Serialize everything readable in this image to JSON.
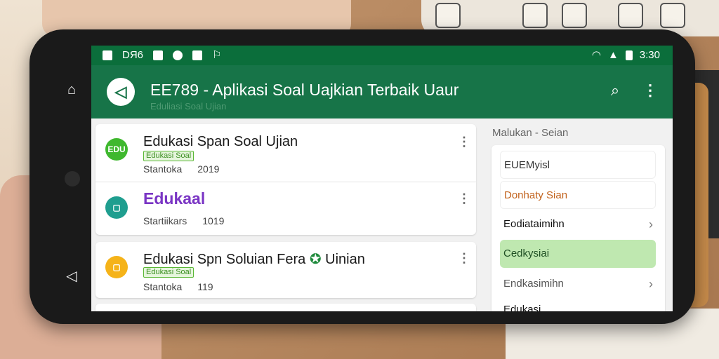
{
  "status_bar": {
    "left_text": "DЯ6",
    "time": "3:30"
  },
  "app_bar": {
    "title": "EE789 - Aplikasi Soal Uajkian Terbaik Uaur",
    "subtitle": "Eduliasi Soal  Ujian"
  },
  "list": {
    "items": [
      {
        "title": "Edukasi Span Soal Ujian",
        "tag": "Edukasi Soal",
        "meta_left": "Stantoka",
        "meta_right": "2019",
        "icon_text": "EDU",
        "icon_color": "#3fb82e",
        "title_color": "#1a1a1a"
      },
      {
        "title": "Edukaal",
        "tag": "",
        "meta_left": "Startiikars",
        "meta_right": "1019",
        "icon_text": "",
        "icon_color": "#1f9e8f",
        "title_color": "#7a35c4"
      },
      {
        "title": "Edukasi Spn Soluian Fera",
        "title_suffix": "Uinian",
        "tag": "Edukasi Soal",
        "meta_left": "Stantoka",
        "meta_right": "119",
        "icon_text": "",
        "icon_color": "#f5b319",
        "title_color": "#1a1a1a"
      }
    ]
  },
  "side_panel": {
    "heading": "Malukan - Seian",
    "items": [
      {
        "label": "EUEMyisl",
        "chevron": false
      },
      {
        "label": "Donhaty Sian",
        "chevron": false
      },
      {
        "label": "Eodiataimihn",
        "chevron": true
      },
      {
        "label": "Cedkysiai",
        "chevron": false
      },
      {
        "label": "Endkasimihn",
        "chevron": true
      },
      {
        "label": "Edukasi",
        "chevron": false
      }
    ]
  },
  "colors": {
    "status_bar": "#0b6e3b",
    "app_bar": "#177448",
    "highlight": "#bfe8b0",
    "tag_green": "#59b834"
  },
  "icons": {
    "logo": "send-arrow-icon",
    "search": "search-icon",
    "more": "more-vert-icon"
  }
}
